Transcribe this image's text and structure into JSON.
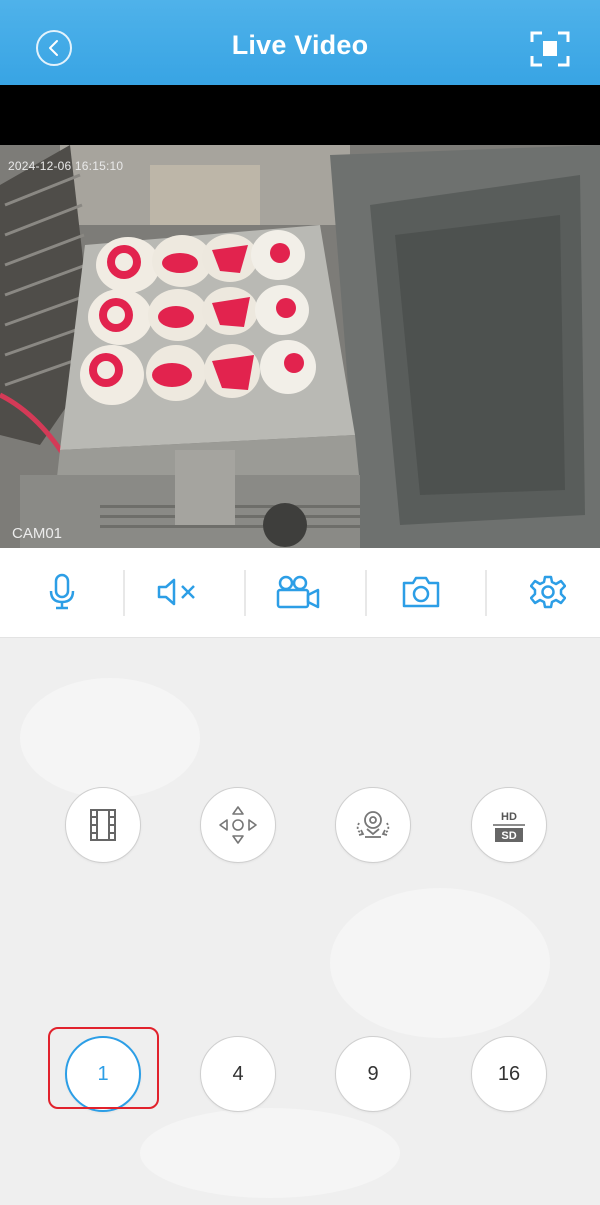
{
  "header": {
    "title": "Live Video",
    "background_color": "#3aa6e5"
  },
  "video": {
    "timestamp": "2024-12-06 16:15:10",
    "camera_label": "CAM01"
  },
  "toolbar": {
    "items": [
      {
        "name": "microphone",
        "icon": "microphone-icon"
      },
      {
        "name": "mute",
        "icon": "speaker-muted-icon"
      },
      {
        "name": "record",
        "icon": "video-camera-icon"
      },
      {
        "name": "snapshot",
        "icon": "camera-icon"
      },
      {
        "name": "settings",
        "icon": "gear-icon"
      }
    ],
    "accent_color": "#2c9ee6"
  },
  "controls": {
    "function_buttons": [
      {
        "name": "playback",
        "icon": "film-icon"
      },
      {
        "name": "ptz",
        "icon": "direction-pad-icon"
      },
      {
        "name": "rotate-view",
        "icon": "camera-rotate-icon"
      },
      {
        "name": "quality",
        "icon": "hd-sd-icon",
        "hd_label": "HD",
        "sd_label": "SD"
      }
    ],
    "layout_buttons": [
      {
        "label": "1",
        "selected": true
      },
      {
        "label": "4",
        "selected": false
      },
      {
        "label": "9",
        "selected": false
      },
      {
        "label": "16",
        "selected": false
      }
    ],
    "highlight_color": "#e1222c"
  }
}
